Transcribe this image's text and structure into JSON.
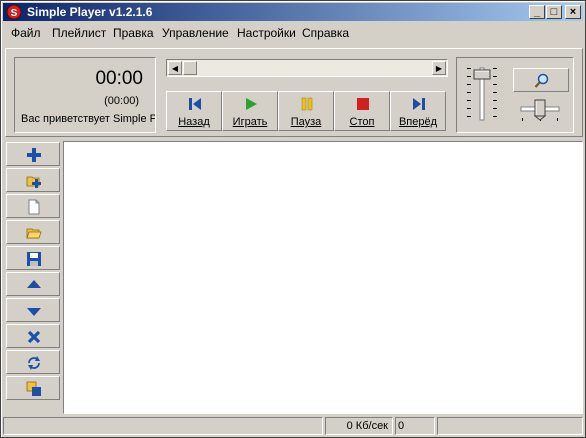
{
  "window": {
    "title": "Simple Player v1.2.1.6"
  },
  "menu": [
    "Файл",
    "Плейлист",
    "Правка",
    "Управление",
    "Настройки",
    "Справка"
  ],
  "display": {
    "time": "00:00",
    "subtime": "(00:00)",
    "message": "Вас приветствует Simple Player"
  },
  "controls": [
    {
      "label": "Назад",
      "icon": "prev-icon"
    },
    {
      "label": "Играть",
      "icon": "play-icon"
    },
    {
      "label": "Пауза",
      "icon": "pause-icon"
    },
    {
      "label": "Стоп",
      "icon": "stop-icon"
    },
    {
      "label": "Вперёд",
      "icon": "next-icon"
    }
  ],
  "sidebar_icons": [
    "add-icon",
    "add-folder-icon",
    "new-playlist-icon",
    "open-playlist-icon",
    "save-playlist-icon",
    "move-up-icon",
    "move-down-icon",
    "remove-icon",
    "shuffle-icon",
    "duplicate-icon"
  ],
  "status": {
    "speed": "0 Кб/сек",
    "count": "0"
  },
  "colors": {
    "title_start": "#0a246a",
    "title_end": "#a6caf0",
    "icon_blue": "#1c4fa8",
    "play_green": "#2da02d",
    "pause_yellow": "#e8c020",
    "stop_red": "#d02020"
  }
}
